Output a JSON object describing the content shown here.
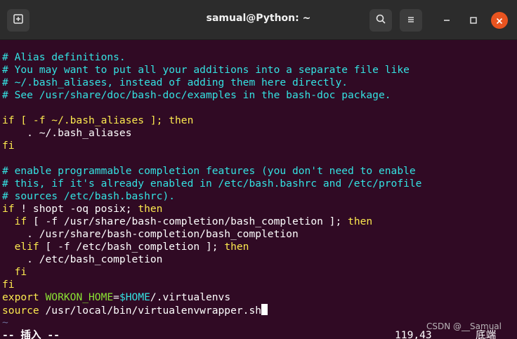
{
  "titlebar": {
    "title": "samual@Python: ~",
    "new_tab_icon": "new-tab-icon",
    "search_icon": "search-icon",
    "menu_icon": "hamburger-menu-icon",
    "minimize_icon": "minimize-icon",
    "maximize_icon": "maximize-icon",
    "close_icon": "close-icon"
  },
  "colors": {
    "background": "#300a24",
    "comment": "#34e2e2",
    "keyword": "#fce94f",
    "variable": "#8ae234",
    "accent_close": "#e95420"
  },
  "editor": {
    "l1": "# Alias definitions.",
    "l2": "# You may want to put all your additions into a separate file like",
    "l3": "# ~/.bash_aliases, instead of adding them here directly.",
    "l4": "# See /usr/share/doc/bash-doc/examples in the bash-doc package.",
    "l6a": "if [ -f ~/.bash_aliases ]; ",
    "l6b": "then",
    "l7": "    . ~/.bash_aliases",
    "l8": "fi",
    "l10": "# enable programmable completion features (you don't need to enable",
    "l11": "# this, if it's already enabled in /etc/bash.bashrc and /etc/profile",
    "l12": "# sources /etc/bash.bashrc).",
    "l13a": "if",
    "l13b": " ! shopt -oq posix; ",
    "l13c": "then",
    "l14a": "  if",
    "l14b": " [ -f /usr/share/bash-completion/bash_completion ]; ",
    "l14c": "then",
    "l15": "    . /usr/share/bash-completion/bash_completion",
    "l16a": "  elif",
    "l16b": " [ -f /etc/bash_completion ]; ",
    "l16c": "then",
    "l17": "    . /etc/bash_completion",
    "l18": "  fi",
    "l19": "fi",
    "l20a": "export",
    "l20b": " ",
    "l20c": "WORKON_HOME",
    "l20d": "=",
    "l20e": "$HOME",
    "l20f": "/.virtualenvs",
    "l21a": "source",
    "l21b": " /usr/local/bin/virtualenvwrapper.sh",
    "tilde": "~"
  },
  "statusline": {
    "mode": "-- 插入 --",
    "position": "119,43",
    "scroll": "底端"
  },
  "watermark": "CSDN @__Samual"
}
